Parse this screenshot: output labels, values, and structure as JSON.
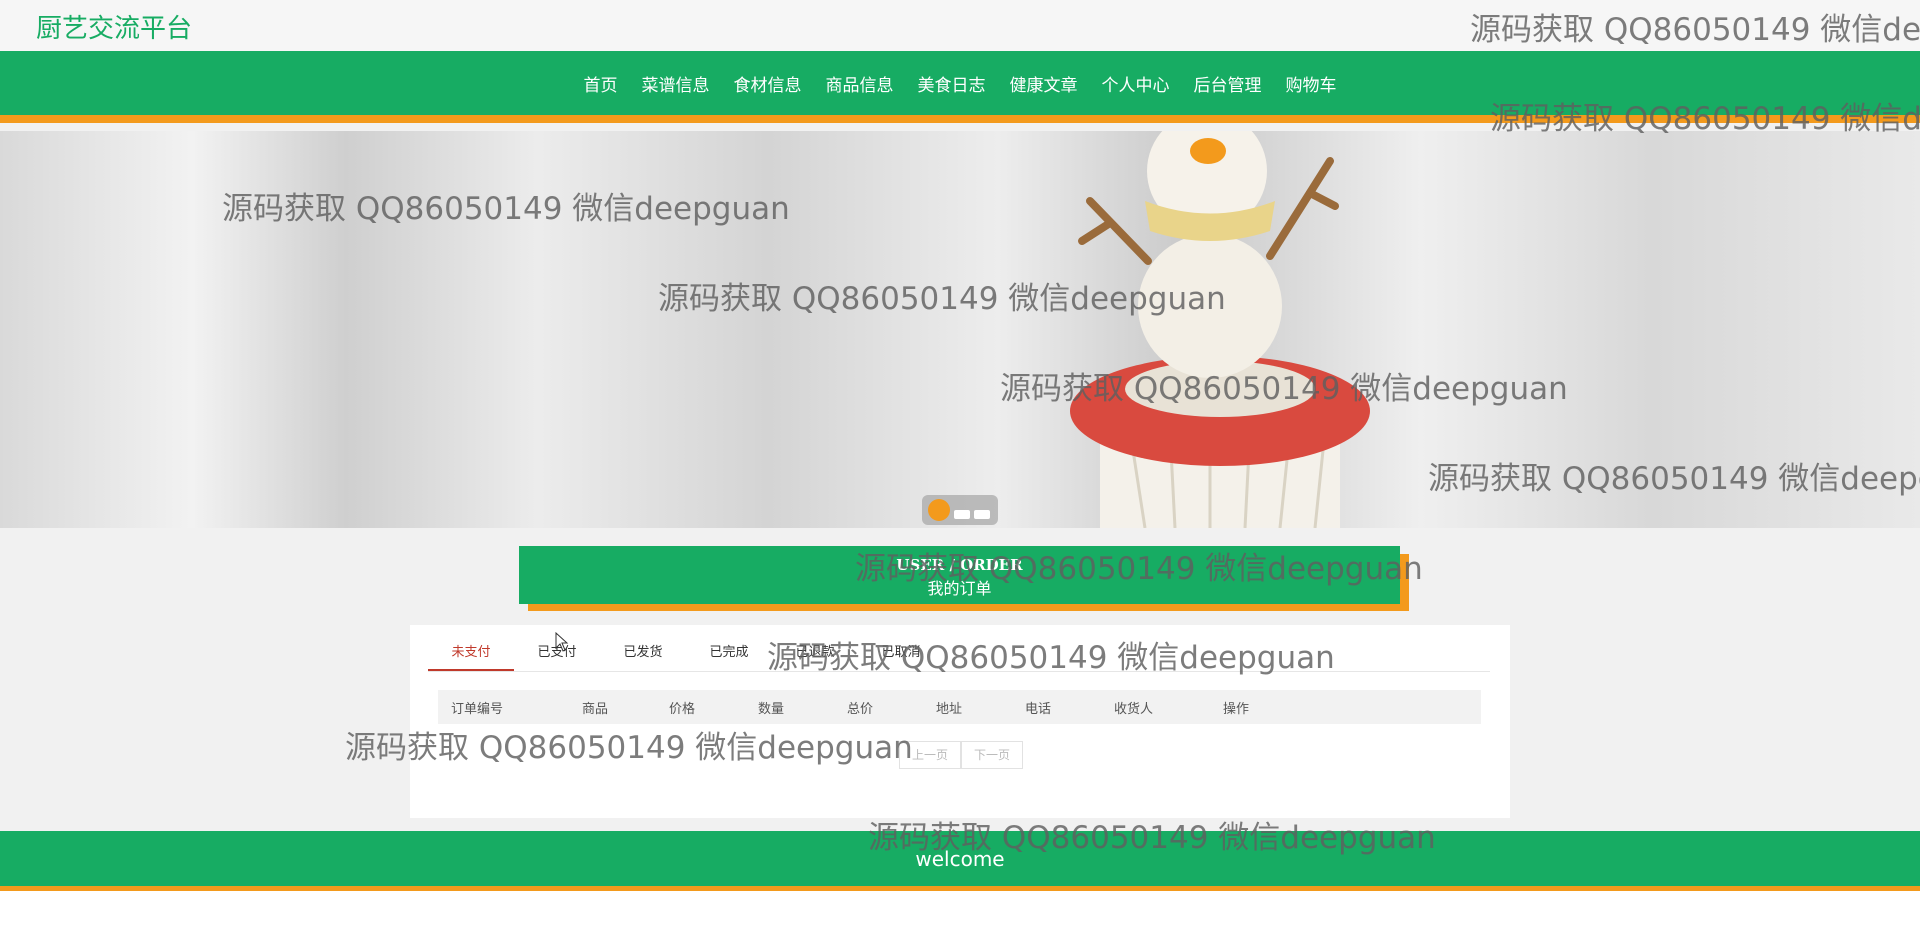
{
  "site": {
    "title": "厨艺交流平台"
  },
  "nav": {
    "items": [
      "首页",
      "菜谱信息",
      "食材信息",
      "商品信息",
      "美食日志",
      "健康文章",
      "个人中心",
      "后台管理",
      "购物车"
    ]
  },
  "section": {
    "title_en": "USER / ORDER",
    "title_cn": "我的订单"
  },
  "tabs": [
    "未支付",
    "已支付",
    "已发货",
    "已完成",
    "已退款",
    "已取消"
  ],
  "table": {
    "headers": [
      "订单编号",
      "商品",
      "价格",
      "数量",
      "总价",
      "地址",
      "电话",
      "收货人",
      "操作"
    ]
  },
  "pager": {
    "prev": "上一页",
    "next": "下一页"
  },
  "footer": {
    "text": "welcome"
  },
  "watermark": "源码获取 QQ86050149 微信deepguan",
  "colors": {
    "brand_green": "#17ac63",
    "accent_orange": "#f39a1c",
    "active_tab": "#c0392b"
  }
}
